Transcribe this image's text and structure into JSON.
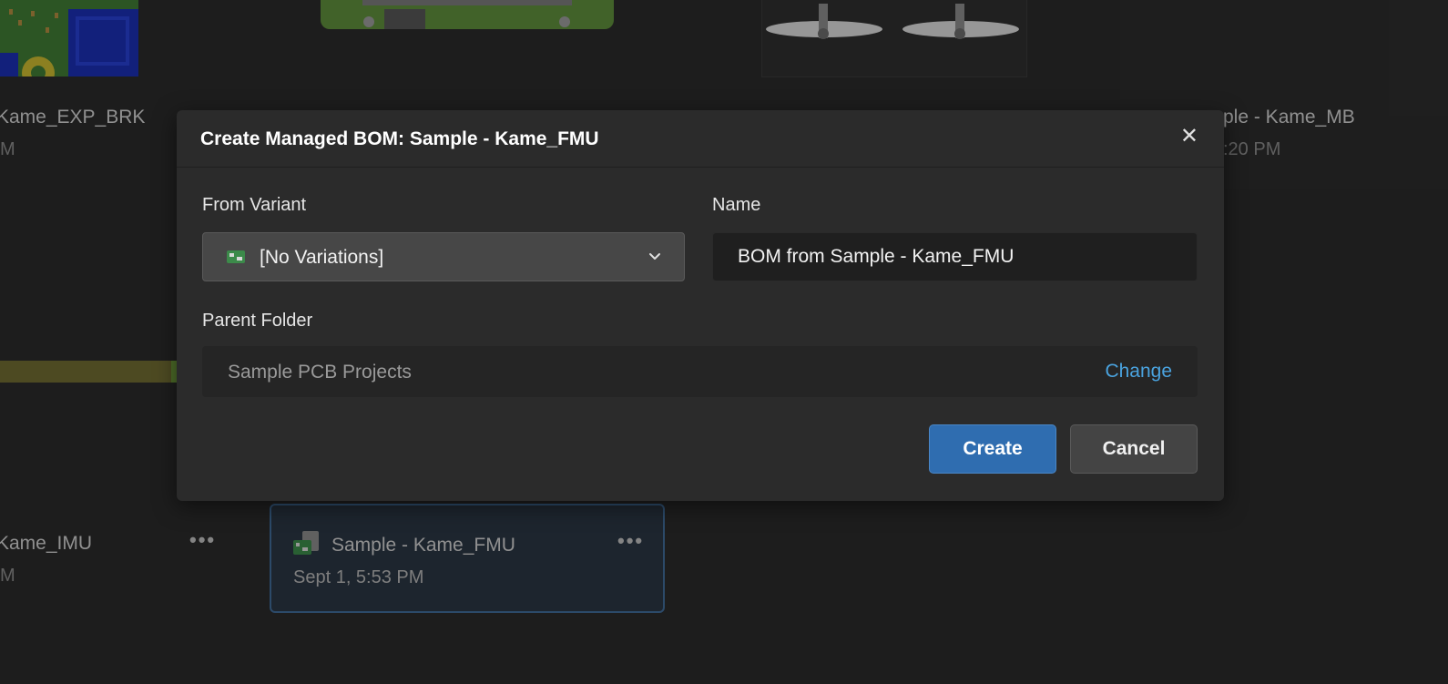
{
  "background": {
    "cards": [
      {
        "title": "Kame_EXP_BRK",
        "subtitle": "M"
      },
      {
        "title": "Kame_IMU",
        "subtitle": "M"
      },
      {
        "title": "ple - Kame_MB",
        "subtitle": ":20 PM"
      }
    ],
    "selected_card": {
      "title": "Sample - Kame_FMU",
      "subtitle": "Sept 1, 5:53 PM"
    }
  },
  "dialog": {
    "title": "Create Managed BOM: Sample - Kame_FMU",
    "close_symbol": "✕",
    "from_variant_label": "From Variant",
    "variant_value": "[No Variations]",
    "name_label": "Name",
    "name_value": "BOM from Sample - Kame_FMU",
    "parent_folder_label": "Parent Folder",
    "parent_folder_value": "Sample PCB Projects",
    "change_label": "Change",
    "create_label": "Create",
    "cancel_label": "Cancel"
  },
  "icons": {
    "more": "more-horizontal-icon",
    "pcb": "pcb-board-icon",
    "chevron": "chevron-down-icon",
    "close": "close-icon"
  },
  "colors": {
    "accent": "#2f6db0",
    "link": "#4aa3df",
    "selected_border": "#3f6a97"
  }
}
